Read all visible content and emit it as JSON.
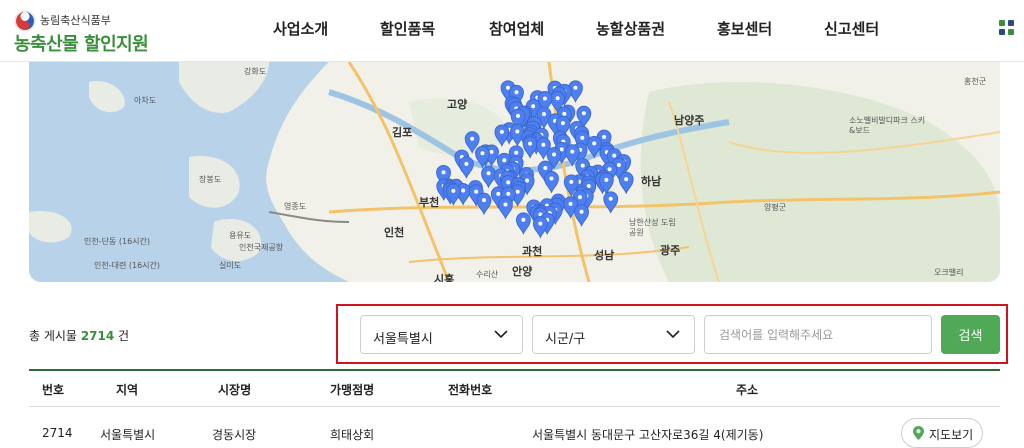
{
  "logo": {
    "ministry": "농림축산식품부",
    "title": "농축산물 할인지원"
  },
  "nav": {
    "items": [
      "사업소개",
      "할인품목",
      "참여업체",
      "농할상품권",
      "홍보센터",
      "신고센터"
    ]
  },
  "map": {
    "labels": [
      "강화도",
      "아차도",
      "김포",
      "고양",
      "남양주",
      "장봉도",
      "인천",
      "영종도",
      "용유도",
      "인천국제공항",
      "부천",
      "과천",
      "하남",
      "광주",
      "성남",
      "시흥",
      "안양",
      "수리산",
      "실미도",
      "양평군",
      "홍천군",
      "인천-단동 (16시간)",
      "인천-대련 (16시간)",
      "소노벨비발디파크 스키&보드",
      "남한산성 도립공원",
      "오크밸리"
    ]
  },
  "summary": {
    "prefix": "총 게시물",
    "count": "2714",
    "suffix": "건"
  },
  "filters": {
    "region": "서울특별시",
    "district": "시군/구",
    "search_placeholder": "검색어를 입력해주세요",
    "search_value": "",
    "search_button": "검색"
  },
  "table": {
    "columns": [
      "번호",
      "지역",
      "시장명",
      "가맹점명",
      "전화번호",
      "주소"
    ],
    "rows": [
      {
        "no": "2714",
        "region": "서울특별시",
        "market": "경동시장",
        "store": "희태상회",
        "phone": "",
        "address": "서울특별시 동대문구 고산자로36길 4(제기동)",
        "map_button": "지도보기"
      }
    ]
  },
  "colors": {
    "brand_green": "#3a8f3a",
    "button_green": "#4fa957",
    "highlight_red": "#d0141e",
    "marker_blue": "#4d7ff0"
  }
}
